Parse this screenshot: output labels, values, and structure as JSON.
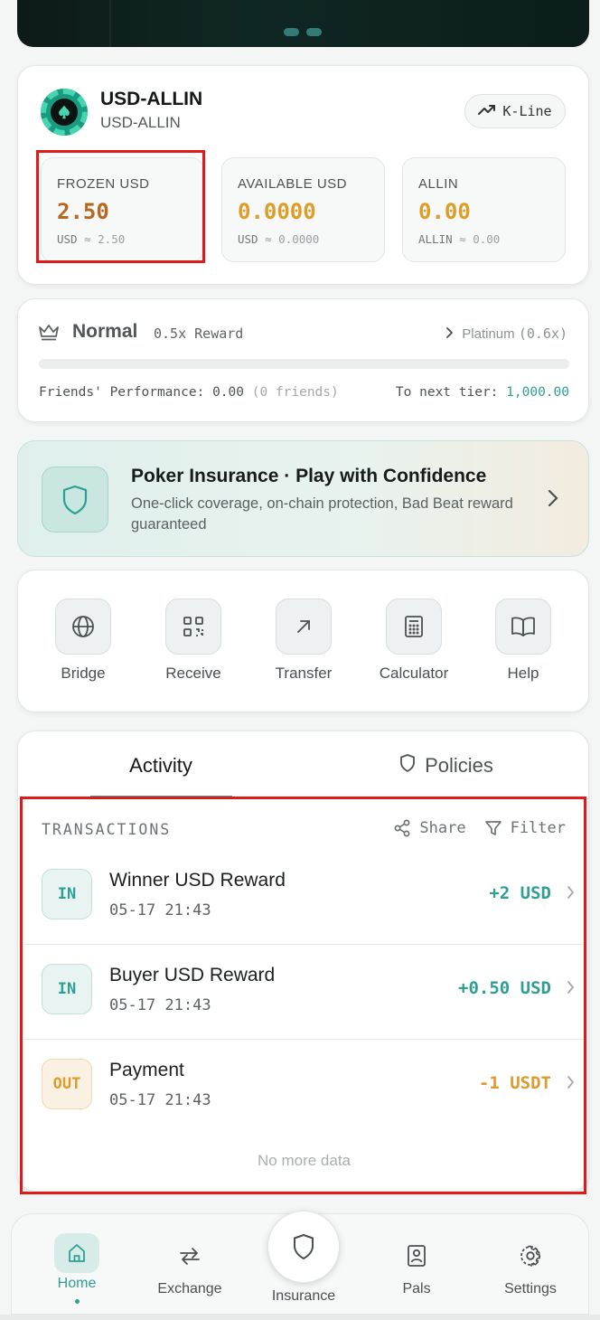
{
  "token": {
    "name": "USD-ALLIN",
    "subtitle": "USD-ALLIN",
    "kline_label": "K-Line"
  },
  "balances": [
    {
      "label": "FROZEN USD",
      "value": "2.50",
      "approx_unit": "USD",
      "approx_value": "≈ 2.50"
    },
    {
      "label": "AVAILABLE USD",
      "value": "0.0000",
      "approx_unit": "USD",
      "approx_value": "≈ 0.0000"
    },
    {
      "label": "ALLIN",
      "value": "0.00",
      "approx_unit": "ALLIN",
      "approx_value": "≈ 0.00"
    }
  ],
  "tier": {
    "name": "Normal",
    "reward": "0.5x Reward",
    "next_name": "Platinum",
    "next_mult": "(0.6x)",
    "progress_fraction": 0,
    "perf_label": "Friends' Performance:",
    "perf_value": "0.00",
    "perf_friends": "(0 friends)",
    "next_tier_label": "To next tier:",
    "next_tier_value": "1,000.00"
  },
  "promo": {
    "title": "Poker Insurance · Play with Confidence",
    "description": "One-click coverage, on-chain protection, Bad Beat reward guaranteed"
  },
  "actions": [
    {
      "label": "Bridge",
      "icon": "globe-icon"
    },
    {
      "label": "Receive",
      "icon": "qr-code-icon"
    },
    {
      "label": "Transfer",
      "icon": "arrow-up-right-icon"
    },
    {
      "label": "Calculator",
      "icon": "calculator-icon"
    },
    {
      "label": "Help",
      "icon": "book-icon"
    }
  ],
  "tabs": {
    "activity": "Activity",
    "policies": "Policies"
  },
  "transactions": {
    "header": "TRANSACTIONS",
    "share_label": "Share",
    "filter_label": "Filter",
    "items": [
      {
        "badge": "IN",
        "title": "Winner USD Reward",
        "time": "05-17 21:43",
        "amount": "+2 USD"
      },
      {
        "badge": "IN",
        "title": "Buyer USD Reward",
        "time": "05-17 21:43",
        "amount": "+0.50 USD"
      },
      {
        "badge": "OUT",
        "title": "Payment",
        "time": "05-17 21:43",
        "amount": "-1 USDT"
      }
    ],
    "no_more": "No more data"
  },
  "nav": {
    "home": "Home",
    "exchange": "Exchange",
    "insurance": "Insurance",
    "pals": "Pals",
    "settings": "Settings"
  },
  "colors": {
    "accent": "#3aa79a",
    "in": "#2f9f93",
    "out": "#df9b2c",
    "highlight": "#e01919"
  }
}
